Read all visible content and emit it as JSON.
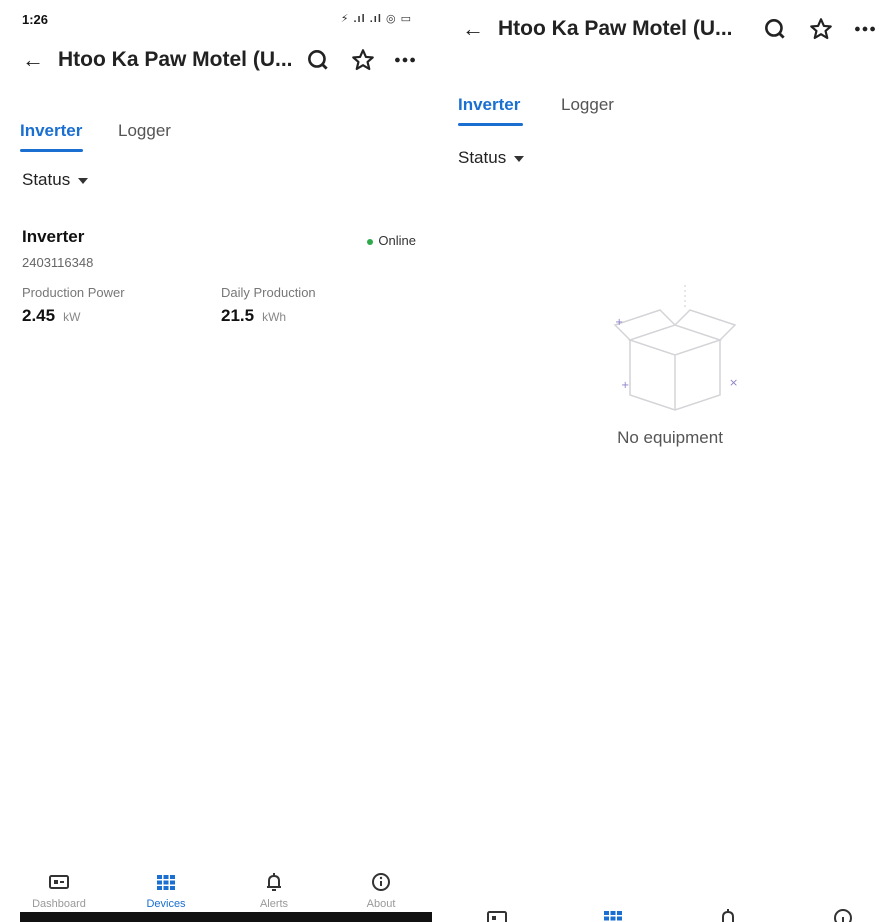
{
  "colors": {
    "accent": "#1a6fd1",
    "online": "#2eaa4a"
  },
  "status_bar": {
    "time": "1:26"
  },
  "header": {
    "title": "Htoo Ka Paw Motel (U...",
    "back_icon": "back-arrow-icon",
    "search_icon": "search-icon",
    "star_icon": "star-icon",
    "more_icon": "more-icon"
  },
  "tabs": [
    {
      "label": "Inverter",
      "active": true
    },
    {
      "label": "Logger",
      "active": false
    }
  ],
  "filter": {
    "label": "Status"
  },
  "device": {
    "name": "Inverter",
    "serial": "2403116348",
    "status": "Online",
    "metrics": [
      {
        "label": "Production Power",
        "value": "2.45",
        "unit": "kW"
      },
      {
        "label": "Daily Production",
        "value": "21.5",
        "unit": "kWh"
      }
    ]
  },
  "empty_state": {
    "text": "No equipment"
  },
  "bottom_nav": [
    {
      "label": "Dashboard",
      "icon": "dashboard-icon",
      "active": false
    },
    {
      "label": "Devices",
      "icon": "devices-icon",
      "active": true
    },
    {
      "label": "Alerts",
      "icon": "alerts-icon",
      "active": false
    },
    {
      "label": "About",
      "icon": "about-icon",
      "active": false
    }
  ]
}
